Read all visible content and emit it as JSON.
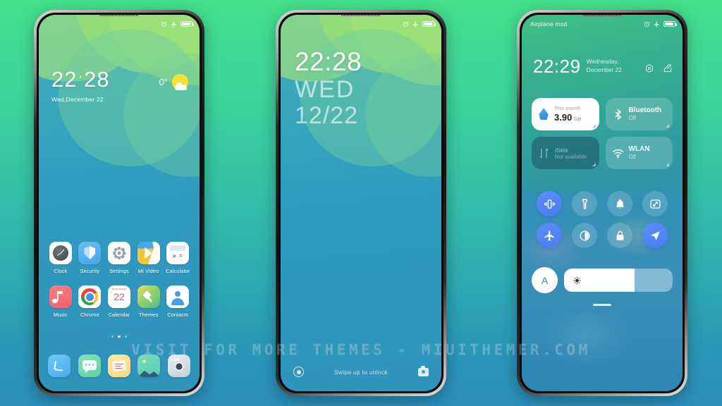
{
  "watermark": "VISIT FOR MORE THEMES - MIUITHEMER.COM",
  "phone1": {
    "name": "home-screen",
    "statusbar": {
      "left_text": "",
      "icons": [
        "alarm-icon",
        "airplane-icon",
        "battery-icon"
      ]
    },
    "clock": {
      "hours": "22",
      "separator": "·",
      "minutes": "28",
      "date": "Wed,December 22"
    },
    "weather": {
      "temp": "0°",
      "icon": "sun-behind-cloud-icon"
    },
    "apps": [
      {
        "label": "Clock",
        "icon": "clock-icon"
      },
      {
        "label": "Security",
        "icon": "shield-icon"
      },
      {
        "label": "Settings",
        "icon": "gear-icon"
      },
      {
        "label": "Mi Video",
        "icon": "play-icon"
      },
      {
        "label": "Calculator",
        "icon": "calculator-icon"
      },
      {
        "label": "Music",
        "icon": "music-note-icon"
      },
      {
        "label": "Chrome",
        "icon": "chrome-icon"
      },
      {
        "label": "Calendar",
        "icon": "calendar-icon",
        "day": "22",
        "weekday": "Wednesday"
      },
      {
        "label": "Themes",
        "icon": "paintbrush-icon"
      },
      {
        "label": "Contacts",
        "icon": "person-icon"
      }
    ],
    "page_dots": {
      "count": 3,
      "active_index": 1
    },
    "dock": [
      {
        "name": "phone-app",
        "icon": "handset-icon"
      },
      {
        "name": "messages-app",
        "icon": "speech-bubble-icon"
      },
      {
        "name": "notes-app",
        "icon": "note-icon"
      },
      {
        "name": "gallery-app",
        "icon": "photo-icon"
      },
      {
        "name": "camera-app",
        "icon": "camera-icon"
      }
    ]
  },
  "phone2": {
    "name": "lock-screen",
    "statusbar": {
      "icons": [
        "alarm-icon",
        "airplane-icon",
        "battery-icon"
      ]
    },
    "clock": {
      "time": "22:28",
      "weekday": "WED",
      "date": "12/22"
    },
    "bottom": {
      "left_icon": "record-circle-icon",
      "hint": "Swipe up to unlock",
      "right_icon": "camera-icon"
    }
  },
  "phone3": {
    "name": "control-center",
    "statusbar": {
      "left_text": "Airplane mod",
      "icons": [
        "alarm-icon",
        "airplane-icon",
        "battery-icon"
      ]
    },
    "header": {
      "time": "22:29",
      "date_line1": "Wednesday,",
      "date_line2": "December 22",
      "icons": [
        "settings-hex-icon",
        "edit-icon"
      ]
    },
    "tiles": [
      {
        "name": "data-usage-tile",
        "style": "light",
        "top": "This month",
        "value": "3.90",
        "unit": "GB",
        "icon": "water-drop-icon"
      },
      {
        "name": "bluetooth-tile",
        "style": "glass",
        "title": "Bluetooth",
        "sub": "Off",
        "icon": "bluetooth-icon"
      },
      {
        "name": "mobile-data-tile",
        "style": "dark",
        "title": "data",
        "sub": "Not available",
        "icon": "data-arrows-icon"
      },
      {
        "name": "wlan-tile",
        "style": "glass",
        "title": "WLAN",
        "sub": "Off",
        "icon": "wifi-icon"
      }
    ],
    "toggles": [
      {
        "name": "vibrate-toggle",
        "icon": "vibrate-icon",
        "active": true
      },
      {
        "name": "flashlight-toggle",
        "icon": "flashlight-icon",
        "active": false
      },
      {
        "name": "ringer-toggle",
        "icon": "bell-icon",
        "active": false
      },
      {
        "name": "screenshot-toggle",
        "icon": "screenshot-icon",
        "active": false
      },
      {
        "name": "airplane-toggle",
        "icon": "airplane-icon",
        "active": true
      },
      {
        "name": "dark-mode-toggle",
        "icon": "contrast-icon",
        "active": false
      },
      {
        "name": "lock-toggle",
        "icon": "lock-icon",
        "active": false
      },
      {
        "name": "location-toggle",
        "icon": "location-arrow-icon",
        "active": true
      }
    ],
    "brightness": {
      "auto_label": "A",
      "icon": "brightness-sun-icon",
      "level": 65
    }
  }
}
